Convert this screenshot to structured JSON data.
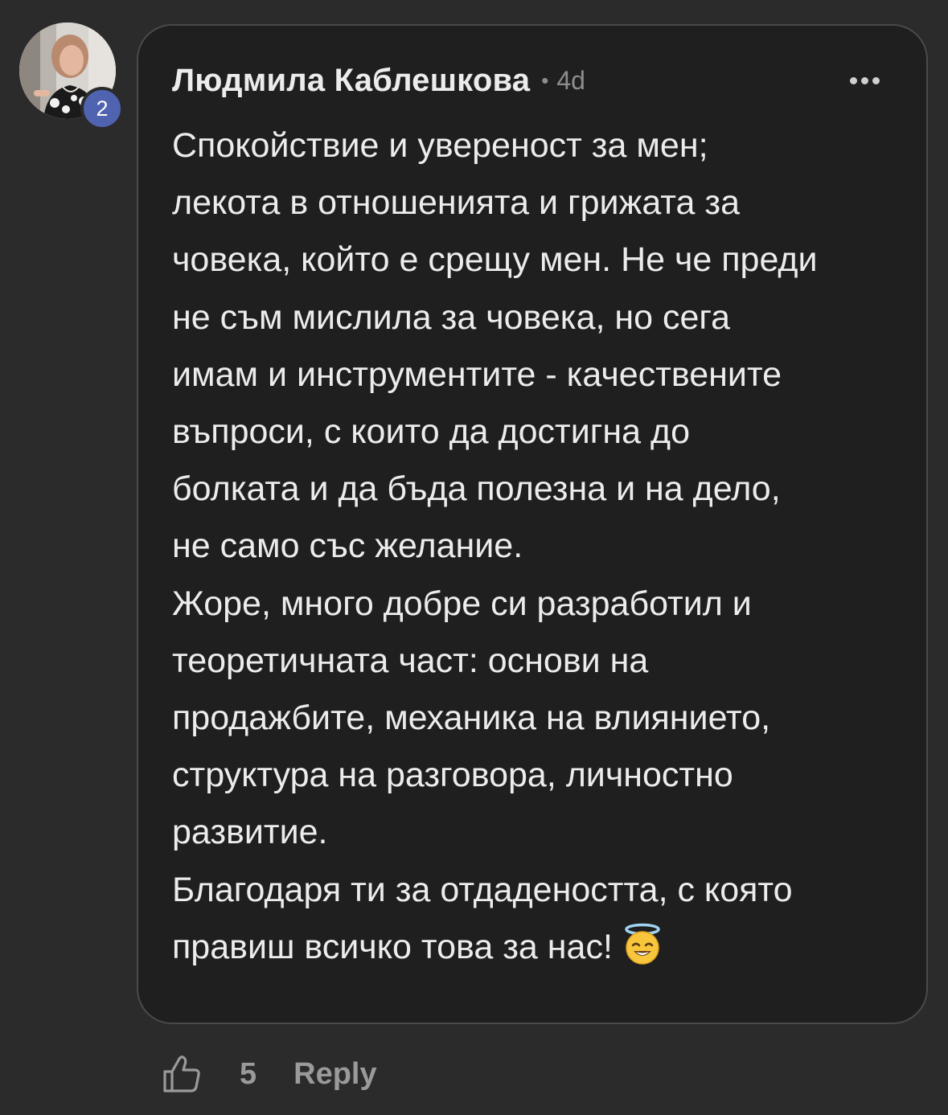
{
  "comment": {
    "author": {
      "name": "Людмила Каблешкова",
      "level": "2",
      "avatar": "profile-photo"
    },
    "separator": "•",
    "time_ago": "4d",
    "menu_icon": "more-horizontal-icon",
    "body_lines": [
      "Спокойствие и увереност за мен;",
      "лекота в отношенията и грижата за",
      "човека, който е срещу мен. Не че преди",
      "не съм мислила за човека, но сега",
      "имам и инструментите - качествените",
      "въпроси, с които да достигна до",
      "болката и да бъда полезна и на дело,",
      "не само със желание.",
      "Жоре, много добре си разработил и",
      "теоретичната част: основи на",
      "продажбите, механика на влиянието,",
      "структура на разговора, личностно",
      "развитие.",
      "Благодаря ти за отдадеността, с която",
      "правиш всичко това за нас!"
    ],
    "emoji": "smiling-face-with-halo",
    "colors": {
      "page_background": "#2b2b2c",
      "card_background": "#1f1f20",
      "card_border": "#4a4a4b",
      "text": "#ececec",
      "muted_text": "#8e8e8f",
      "level_badge": "#4f63b0"
    }
  },
  "actions": {
    "like_icon": "thumbs-up-icon",
    "like_count": "5",
    "reply_label": "Reply"
  }
}
